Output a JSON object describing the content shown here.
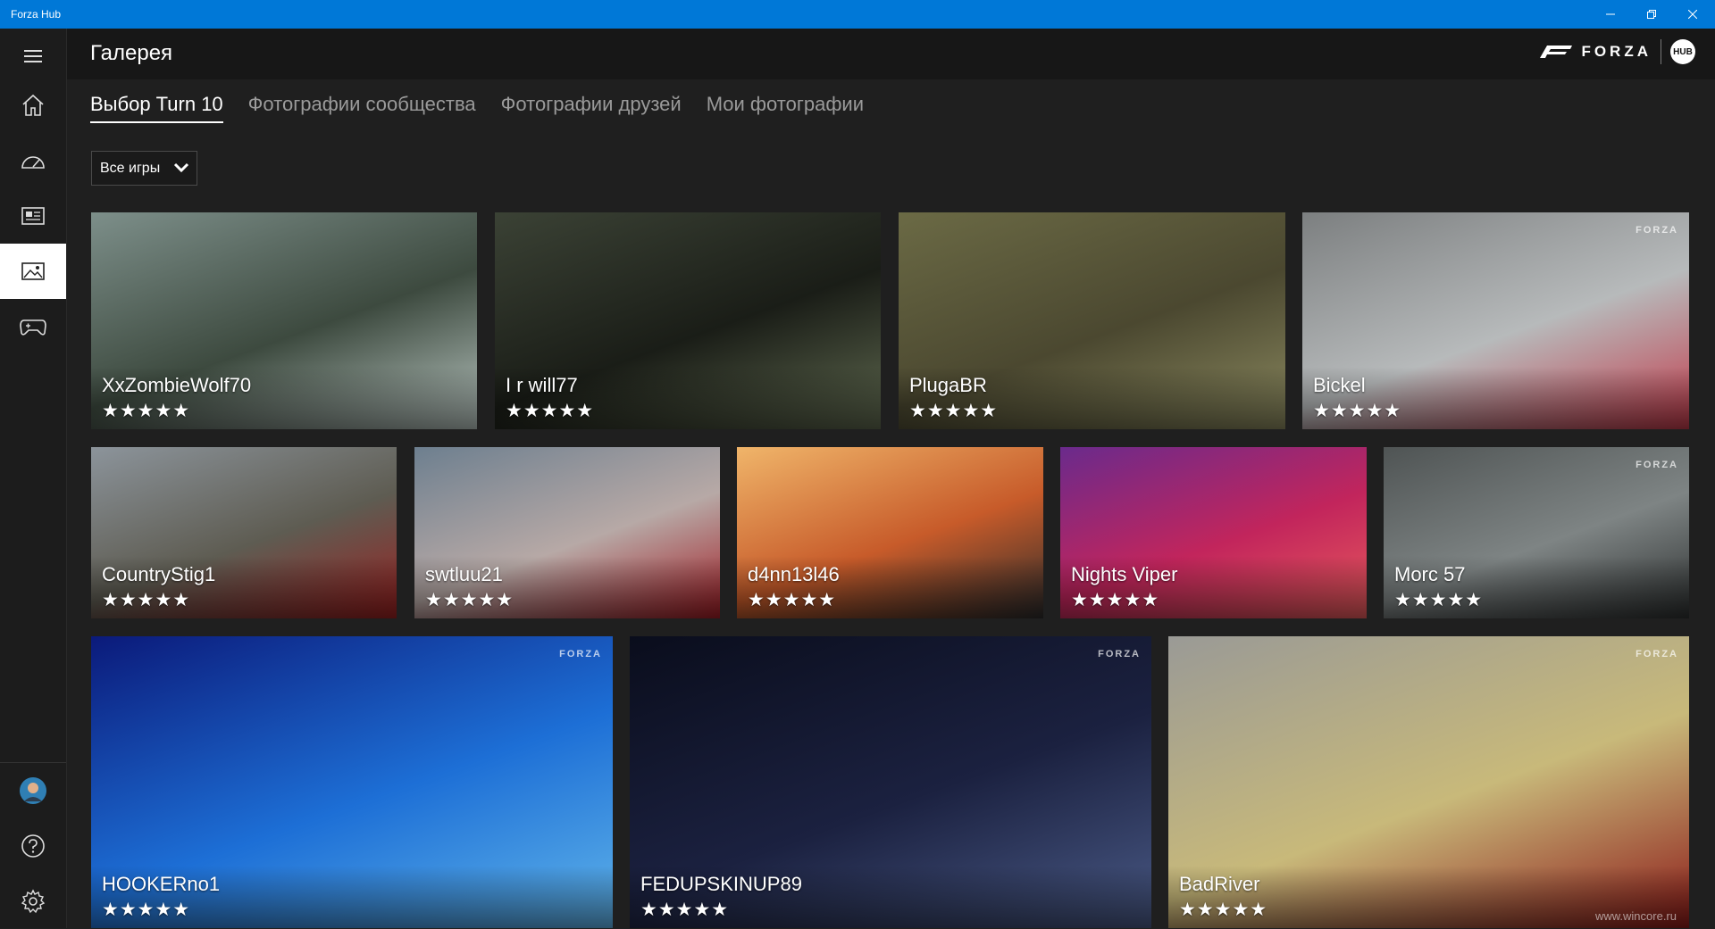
{
  "window": {
    "title": "Forza Hub",
    "controls": {
      "minimize": "minimize-icon",
      "restore": "restore-icon",
      "close": "close-icon"
    }
  },
  "colors": {
    "titlebar": "#0078d7",
    "sidebar": "#1c1c1c",
    "header": "#171717",
    "background": "#1f1f1f",
    "active_nav": "#ffffff"
  },
  "sidebar": {
    "items": [
      {
        "id": "menu",
        "icon": "hamburger-menu-icon"
      },
      {
        "id": "home",
        "icon": "home-icon"
      },
      {
        "id": "dashboard",
        "icon": "speedometer-icon"
      },
      {
        "id": "news",
        "icon": "news-icon"
      },
      {
        "id": "gallery",
        "icon": "gallery-icon",
        "active": true
      },
      {
        "id": "games",
        "icon": "gamepad-icon"
      }
    ],
    "bottom": [
      {
        "id": "profile",
        "icon": "avatar-icon"
      },
      {
        "id": "help",
        "icon": "help-icon"
      },
      {
        "id": "settings",
        "icon": "settings-icon"
      }
    ]
  },
  "header": {
    "title": "Галерея",
    "logo_text": "FORZA",
    "badge": "HUB"
  },
  "tabs": [
    {
      "label": "Выбор Turn 10",
      "active": true
    },
    {
      "label": "Фотографии сообщества"
    },
    {
      "label": "Фотографии друзей"
    },
    {
      "label": "Мои фотографии"
    }
  ],
  "filter": {
    "label": "Все игры",
    "icon": "chevron-down-icon"
  },
  "gallery": {
    "rows": [
      [
        {
          "author": "XxZombieWolf70",
          "stars": "★★★★★",
          "scene": "white-porsche-cliffs",
          "palette": [
            "#7d8f8a",
            "#3d4a3f",
            "#b9c6c1"
          ]
        },
        {
          "author": "I r will77",
          "stars": "★★★★★",
          "scene": "dark-car-motion-blur",
          "palette": [
            "#3b4235",
            "#1a1d17",
            "#606a50"
          ]
        },
        {
          "author": "PlugaBR",
          "stars": "★★★★★",
          "scene": "silver-car-dirt-road",
          "palette": [
            "#6b6a45",
            "#4b4830",
            "#8c8a60"
          ]
        },
        {
          "author": "Bickel",
          "stars": "★★★★★",
          "scene": "race-track-curbs",
          "palette": [
            "#7c7f80",
            "#b7babb",
            "#c23b4b"
          ],
          "watermark": "FORZA"
        }
      ],
      [
        {
          "author": "CountryStig1",
          "stars": "★★★★★",
          "scene": "red-classic-castle",
          "palette": [
            "#8c949b",
            "#5e5c52",
            "#9b2020"
          ]
        },
        {
          "author": "swtluu21",
          "stars": "★★★★★",
          "scene": "red-coupe-carnival",
          "palette": [
            "#6d7f8f",
            "#b7a9a6",
            "#a21c24"
          ]
        },
        {
          "author": "d4nn13l46",
          "stars": "★★★★★",
          "scene": "sunset-mountains",
          "palette": [
            "#f0b56a",
            "#c75b2a",
            "#2b2b2b"
          ]
        },
        {
          "author": "Nights Viper",
          "stars": "★★★★★",
          "scene": "pink-toyota-neon",
          "palette": [
            "#6a2a8c",
            "#c2255c",
            "#e85c5c"
          ]
        },
        {
          "author": "Morc 57",
          "stars": "★★★★★",
          "scene": "vintage-f1-car",
          "palette": [
            "#4f5454",
            "#7e8484",
            "#2d3030"
          ],
          "watermark": "FORZA"
        }
      ],
      [
        {
          "author": "HOOKERno1",
          "stars": "★★★★★",
          "scene": "rolls-royce-emblem",
          "palette": [
            "#0b1a7a",
            "#1d6fd6",
            "#60b4ea"
          ],
          "watermark": "FORZA"
        },
        {
          "author": "FEDUPSKINUP89",
          "stars": "★★★★★",
          "scene": "night-car-street",
          "palette": [
            "#0a0d1c",
            "#1b2140",
            "#4a5a86"
          ],
          "watermark": "FORZA"
        },
        {
          "author": "BadRiver",
          "stars": "★★★★★",
          "scene": "ferrari-classic-poster",
          "palette": [
            "#9a9a96",
            "#c8b97a",
            "#8c1a18"
          ],
          "watermark": "FORZA"
        }
      ]
    ],
    "source_watermark": "www.wincore.ru"
  }
}
